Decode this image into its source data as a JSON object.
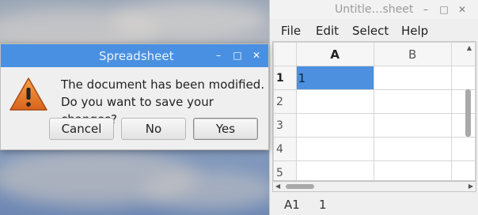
{
  "spreadsheet_window": {
    "title": "Untitle…sheet",
    "controls": {
      "minimize": "–",
      "maximize": "□",
      "close": "✕"
    },
    "menu": [
      "File",
      "Edit",
      "Select",
      "Help"
    ],
    "columns": [
      "A",
      "B"
    ],
    "rows": [
      {
        "header": "1",
        "cells": [
          "1",
          ""
        ]
      },
      {
        "header": "2",
        "cells": [
          "",
          ""
        ]
      },
      {
        "header": "3",
        "cells": [
          "",
          ""
        ]
      },
      {
        "header": "4",
        "cells": [
          "",
          ""
        ]
      },
      {
        "header": "5",
        "cells": [
          "",
          ""
        ]
      }
    ],
    "status": {
      "cell_ref": "A1",
      "cell_value": "1"
    }
  },
  "dialog": {
    "title": "Spreadsheet",
    "controls": {
      "minimize": "–",
      "maximize": "□",
      "close": "✕"
    },
    "message_line1": "The document has been modified.",
    "message_line2": "Do you want to save your changes?",
    "icon": "warning-icon",
    "buttons": {
      "cancel": "Cancel",
      "no": "No",
      "yes": "Yes"
    }
  },
  "colors": {
    "titlebar_active": "#4a90e2",
    "selection": "#4d90e0",
    "warning": "#e8781e"
  }
}
